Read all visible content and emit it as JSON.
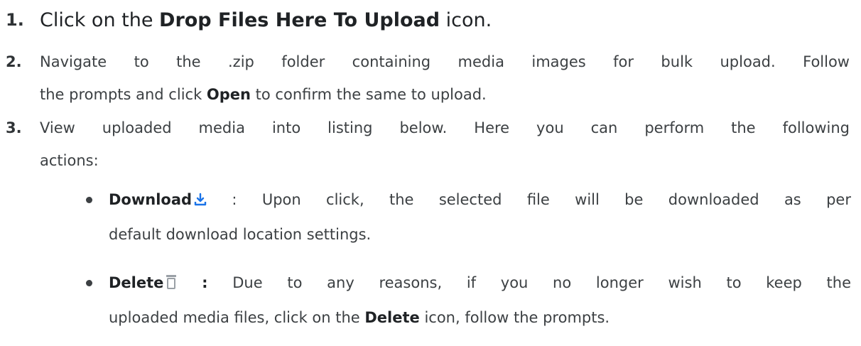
{
  "steps": [
    {
      "number": "1.",
      "before": "Click on the ",
      "bold": "Drop Files Here To Upload",
      "after": " icon."
    },
    {
      "number": "2.",
      "line1": "Navigate to the .zip folder containing media images for bulk upload. Follow",
      "line2_before": "the prompts and click ",
      "line2_bold": "Open",
      "line2_after": " to confirm the same to upload."
    },
    {
      "number": "3.",
      "line1": "View uploaded media into listing below. Here you can perform the following",
      "line2": "actions:"
    }
  ],
  "actions": [
    {
      "name": "Download",
      "icon": "download-icon",
      "line1": ": Upon click, the selected file will be downloaded as per",
      "line2": "default download location settings."
    },
    {
      "name": "Delete",
      "icon": "trash-icon",
      "line1_rest": "Due to any reasons, if you no longer wish to keep the",
      "line2_before": "uploaded media files, click on the ",
      "line2_bold": "Delete",
      "line2_after": " icon, follow the prompts."
    }
  ],
  "colors": {
    "text": "#3c4043",
    "download_icon": "#1a73e8",
    "delete_icon": "#9aa0a6"
  }
}
